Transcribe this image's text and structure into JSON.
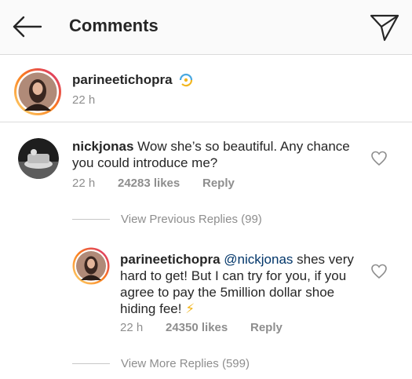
{
  "header": {
    "title": "Comments",
    "back_icon": "arrow-left-icon",
    "send_icon": "paper-plane-icon"
  },
  "caption": {
    "username": "parineetichopra",
    "badge_icon": "sparkle-emoji-icon",
    "time": "22 h"
  },
  "comment": {
    "username": "nickjonas",
    "text_line1": "Wow she’s so beautiful. Any chance",
    "text_line2": "you could introduce me?",
    "time": "22 h",
    "likes": "24283 likes",
    "reply_label": "Reply"
  },
  "view_previous": "View Previous Replies (99)",
  "reply": {
    "username": "parineetichopra",
    "mention": "@nickjonas",
    "text_line1_rest": " shes very",
    "text_line2": "hard to get! But I can try for you, if you",
    "text_line3": "agree to pay the 5million dollar shoe",
    "text_line4": "hiding fee!",
    "emoji": "⚡",
    "time": "22 h",
    "likes": "24350 likes",
    "reply_label": "Reply"
  },
  "view_more": "View More Replies (599)",
  "colors": {
    "text": "#262626",
    "secondary": "#8e8e8e",
    "mention": "#003569",
    "story_ring_start": "#feda75",
    "story_ring_end": "#d62976"
  }
}
